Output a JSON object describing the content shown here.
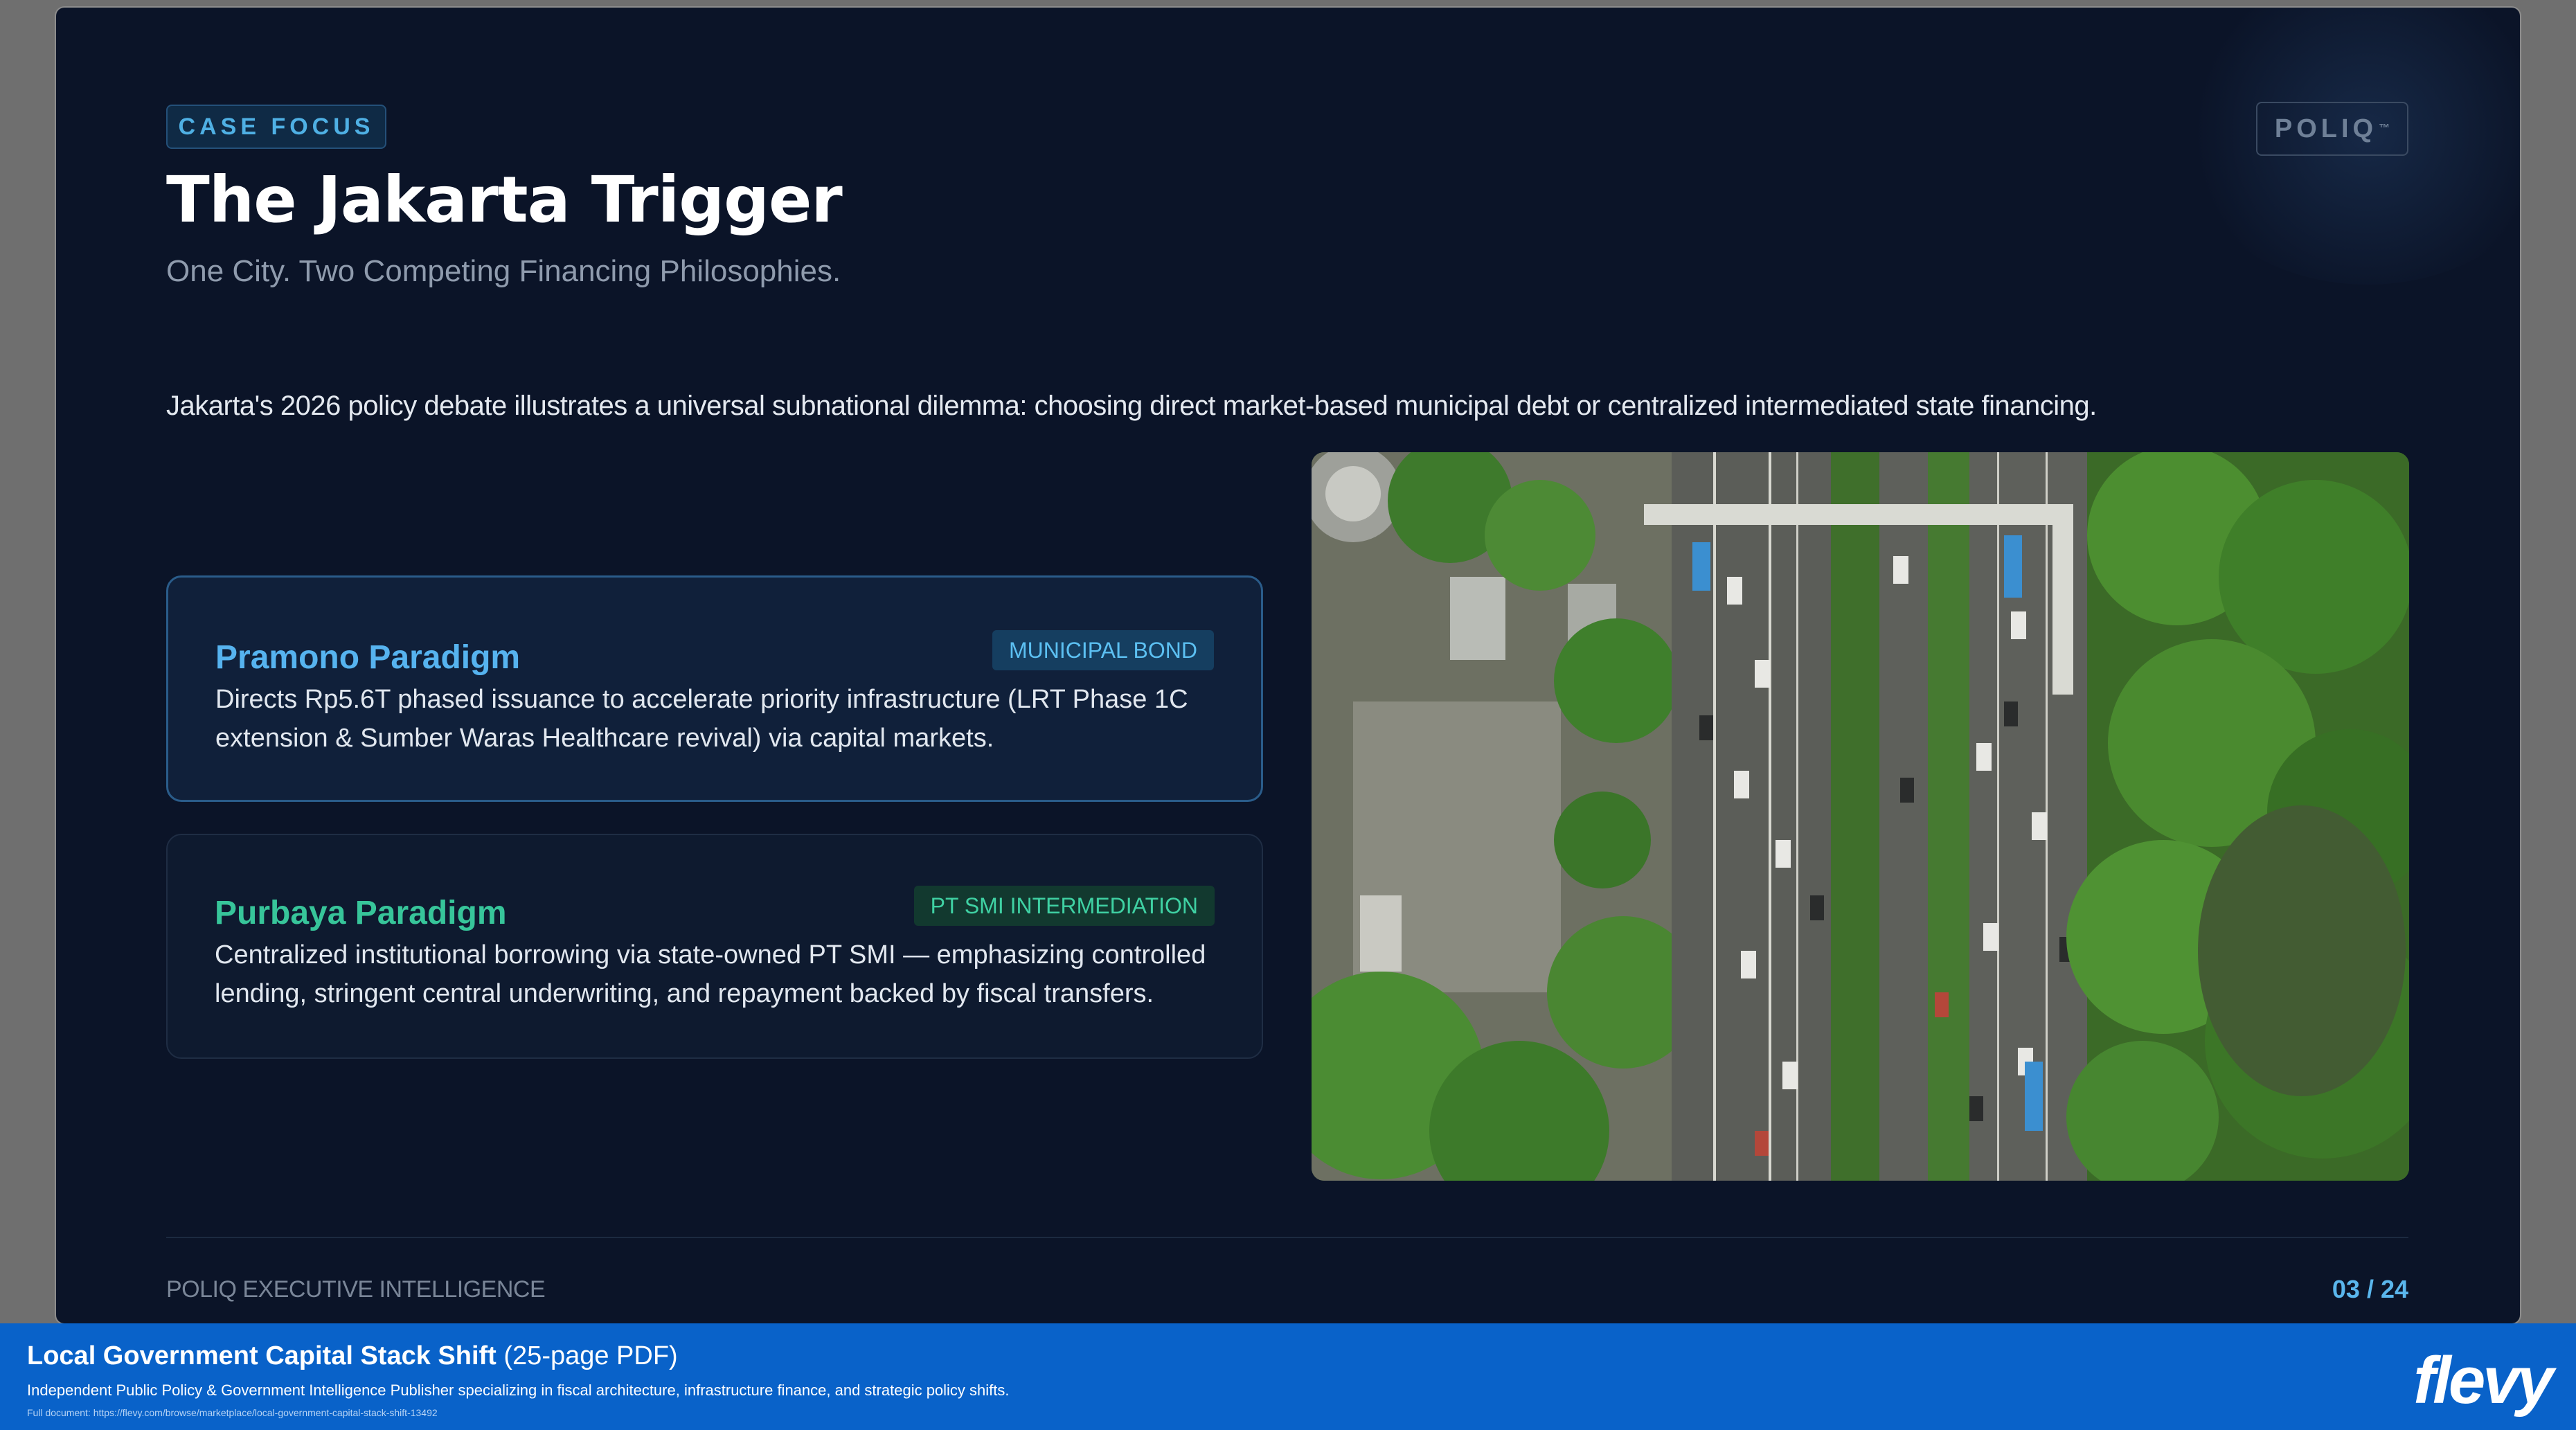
{
  "slide": {
    "tag": "CASE FOCUS",
    "brand": "POLIQ",
    "brand_mark": "™",
    "title": "The Jakarta Trigger",
    "subtitle": "One City. Two Competing Financing Philosophies.",
    "intro": "Jakarta's 2026 policy debate illustrates a universal subnational dilemma: choosing direct market-based municipal debt or centralized intermediated state financing."
  },
  "cards": [
    {
      "name": "Pramono Paradigm",
      "badge": "MUNICIPAL BOND",
      "body": "Directs Rp5.6T phased issuance to accelerate priority infrastructure (LRT Phase 1C extension & Sumber Waras Healthcare revival) via capital markets."
    },
    {
      "name": "Purbaya Paradigm",
      "badge": "PT SMI INTERMEDIATION",
      "body": "Centralized institutional borrowing via state-owned PT SMI — emphasizing controlled lending, stringent central underwriting, and repayment backed by fiscal transfers."
    }
  ],
  "photo": {
    "icon": "aerial-highway-photo"
  },
  "footer": {
    "left": "POLIQ EXECUTIVE INTELLIGENCE",
    "page": "03 / 24"
  },
  "banner": {
    "doc_title": "Local Government Capital Stack Shift",
    "doc_pages": "(25-page PDF)",
    "description": "Independent Public Policy & Government Intelligence Publisher specializing in fiscal architecture, infrastructure finance, and strategic policy shifts.",
    "link": "Full document: https://flevy.com/browse/marketplace/local-government-capital-stack-shift-13492",
    "logo": "flevy"
  },
  "colors": {
    "slide_bg": "#0b1428",
    "accent_blue": "#56b3ef",
    "accent_green": "#37c59a",
    "banner_bg": "#0962c9"
  }
}
